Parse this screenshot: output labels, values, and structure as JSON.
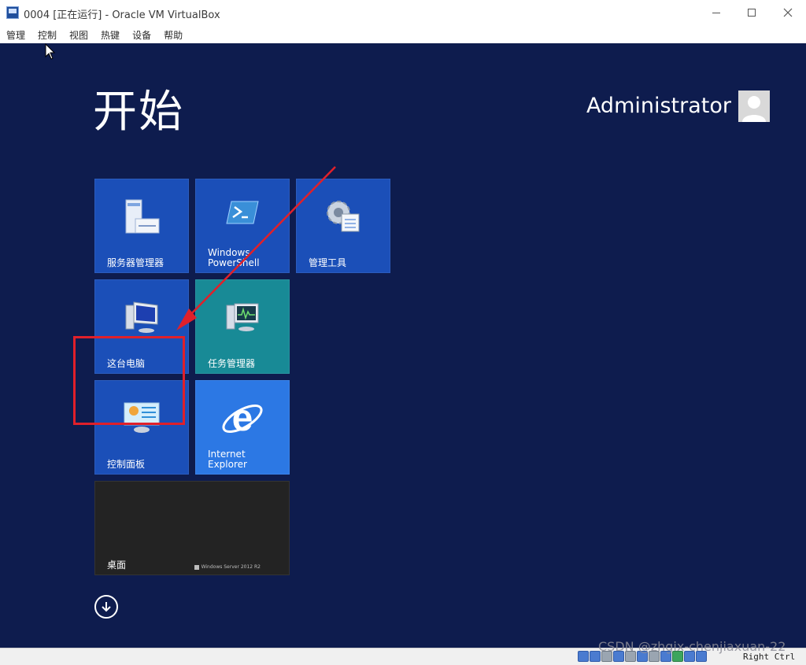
{
  "window": {
    "title": "0004 [正在运行] - Oracle VM VirtualBox"
  },
  "menu": {
    "items": [
      "管理",
      "控制",
      "视图",
      "热键",
      "设备",
      "帮助"
    ]
  },
  "start_screen": {
    "title": "开始",
    "user": "Administrator",
    "tiles": [
      {
        "label": "服务器管理器",
        "icon": "server-manager-icon"
      },
      {
        "label": "Windows\nPowerShell",
        "icon": "powershell-icon"
      },
      {
        "label": "管理工具",
        "icon": "admin-tools-icon"
      },
      {
        "label": "这台电脑",
        "icon": "computer-icon"
      },
      {
        "label": "任务管理器",
        "icon": "task-manager-icon"
      },
      {
        "label": "控制面板",
        "icon": "control-panel-icon"
      },
      {
        "label": "Internet\nExplorer",
        "icon": "internet-explorer-icon"
      },
      {
        "label": "桌面",
        "icon": ""
      }
    ],
    "desktop_brand": "Windows Server 2012 R2"
  },
  "statusbar": {
    "host_key": "Right Ctrl"
  },
  "watermark": "CSDN @zhgix-chenjiaxuan-22",
  "colors": {
    "vm_background": "#0e1c4e",
    "tile_blue": "#1b4fb8",
    "tile_teal": "#188a96",
    "tile_ie": "#2c78e4",
    "annotation_red": "#e0202a"
  }
}
